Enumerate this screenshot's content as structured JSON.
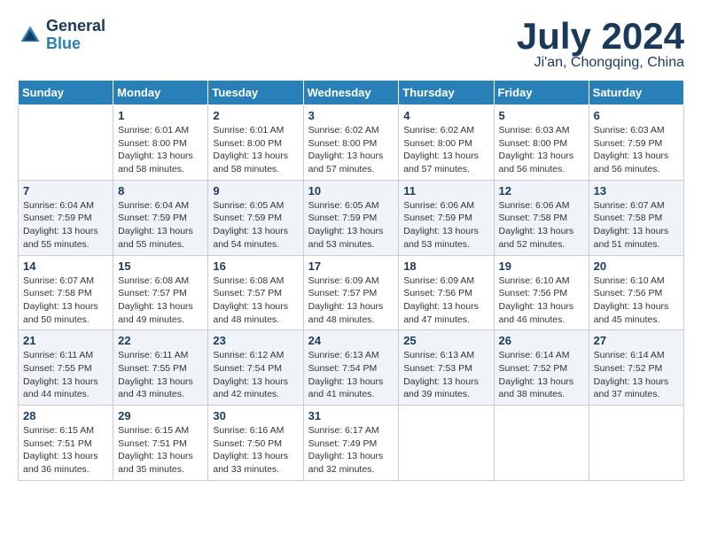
{
  "header": {
    "logo_line1": "General",
    "logo_line2": "Blue",
    "main_title": "July 2024",
    "subtitle": "Ji'an, Chongqing, China"
  },
  "columns": [
    "Sunday",
    "Monday",
    "Tuesday",
    "Wednesday",
    "Thursday",
    "Friday",
    "Saturday"
  ],
  "weeks": [
    [
      {
        "day": "",
        "info": ""
      },
      {
        "day": "1",
        "info": "Sunrise: 6:01 AM\nSunset: 8:00 PM\nDaylight: 13 hours\nand 58 minutes."
      },
      {
        "day": "2",
        "info": "Sunrise: 6:01 AM\nSunset: 8:00 PM\nDaylight: 13 hours\nand 58 minutes."
      },
      {
        "day": "3",
        "info": "Sunrise: 6:02 AM\nSunset: 8:00 PM\nDaylight: 13 hours\nand 57 minutes."
      },
      {
        "day": "4",
        "info": "Sunrise: 6:02 AM\nSunset: 8:00 PM\nDaylight: 13 hours\nand 57 minutes."
      },
      {
        "day": "5",
        "info": "Sunrise: 6:03 AM\nSunset: 8:00 PM\nDaylight: 13 hours\nand 56 minutes."
      },
      {
        "day": "6",
        "info": "Sunrise: 6:03 AM\nSunset: 7:59 PM\nDaylight: 13 hours\nand 56 minutes."
      }
    ],
    [
      {
        "day": "7",
        "info": "Sunrise: 6:04 AM\nSunset: 7:59 PM\nDaylight: 13 hours\nand 55 minutes."
      },
      {
        "day": "8",
        "info": "Sunrise: 6:04 AM\nSunset: 7:59 PM\nDaylight: 13 hours\nand 55 minutes."
      },
      {
        "day": "9",
        "info": "Sunrise: 6:05 AM\nSunset: 7:59 PM\nDaylight: 13 hours\nand 54 minutes."
      },
      {
        "day": "10",
        "info": "Sunrise: 6:05 AM\nSunset: 7:59 PM\nDaylight: 13 hours\nand 53 minutes."
      },
      {
        "day": "11",
        "info": "Sunrise: 6:06 AM\nSunset: 7:59 PM\nDaylight: 13 hours\nand 53 minutes."
      },
      {
        "day": "12",
        "info": "Sunrise: 6:06 AM\nSunset: 7:58 PM\nDaylight: 13 hours\nand 52 minutes."
      },
      {
        "day": "13",
        "info": "Sunrise: 6:07 AM\nSunset: 7:58 PM\nDaylight: 13 hours\nand 51 minutes."
      }
    ],
    [
      {
        "day": "14",
        "info": "Sunrise: 6:07 AM\nSunset: 7:58 PM\nDaylight: 13 hours\nand 50 minutes."
      },
      {
        "day": "15",
        "info": "Sunrise: 6:08 AM\nSunset: 7:57 PM\nDaylight: 13 hours\nand 49 minutes."
      },
      {
        "day": "16",
        "info": "Sunrise: 6:08 AM\nSunset: 7:57 PM\nDaylight: 13 hours\nand 48 minutes."
      },
      {
        "day": "17",
        "info": "Sunrise: 6:09 AM\nSunset: 7:57 PM\nDaylight: 13 hours\nand 48 minutes."
      },
      {
        "day": "18",
        "info": "Sunrise: 6:09 AM\nSunset: 7:56 PM\nDaylight: 13 hours\nand 47 minutes."
      },
      {
        "day": "19",
        "info": "Sunrise: 6:10 AM\nSunset: 7:56 PM\nDaylight: 13 hours\nand 46 minutes."
      },
      {
        "day": "20",
        "info": "Sunrise: 6:10 AM\nSunset: 7:56 PM\nDaylight: 13 hours\nand 45 minutes."
      }
    ],
    [
      {
        "day": "21",
        "info": "Sunrise: 6:11 AM\nSunset: 7:55 PM\nDaylight: 13 hours\nand 44 minutes."
      },
      {
        "day": "22",
        "info": "Sunrise: 6:11 AM\nSunset: 7:55 PM\nDaylight: 13 hours\nand 43 minutes."
      },
      {
        "day": "23",
        "info": "Sunrise: 6:12 AM\nSunset: 7:54 PM\nDaylight: 13 hours\nand 42 minutes."
      },
      {
        "day": "24",
        "info": "Sunrise: 6:13 AM\nSunset: 7:54 PM\nDaylight: 13 hours\nand 41 minutes."
      },
      {
        "day": "25",
        "info": "Sunrise: 6:13 AM\nSunset: 7:53 PM\nDaylight: 13 hours\nand 39 minutes."
      },
      {
        "day": "26",
        "info": "Sunrise: 6:14 AM\nSunset: 7:52 PM\nDaylight: 13 hours\nand 38 minutes."
      },
      {
        "day": "27",
        "info": "Sunrise: 6:14 AM\nSunset: 7:52 PM\nDaylight: 13 hours\nand 37 minutes."
      }
    ],
    [
      {
        "day": "28",
        "info": "Sunrise: 6:15 AM\nSunset: 7:51 PM\nDaylight: 13 hours\nand 36 minutes."
      },
      {
        "day": "29",
        "info": "Sunrise: 6:15 AM\nSunset: 7:51 PM\nDaylight: 13 hours\nand 35 minutes."
      },
      {
        "day": "30",
        "info": "Sunrise: 6:16 AM\nSunset: 7:50 PM\nDaylight: 13 hours\nand 33 minutes."
      },
      {
        "day": "31",
        "info": "Sunrise: 6:17 AM\nSunset: 7:49 PM\nDaylight: 13 hours\nand 32 minutes."
      },
      {
        "day": "",
        "info": ""
      },
      {
        "day": "",
        "info": ""
      },
      {
        "day": "",
        "info": ""
      }
    ]
  ]
}
